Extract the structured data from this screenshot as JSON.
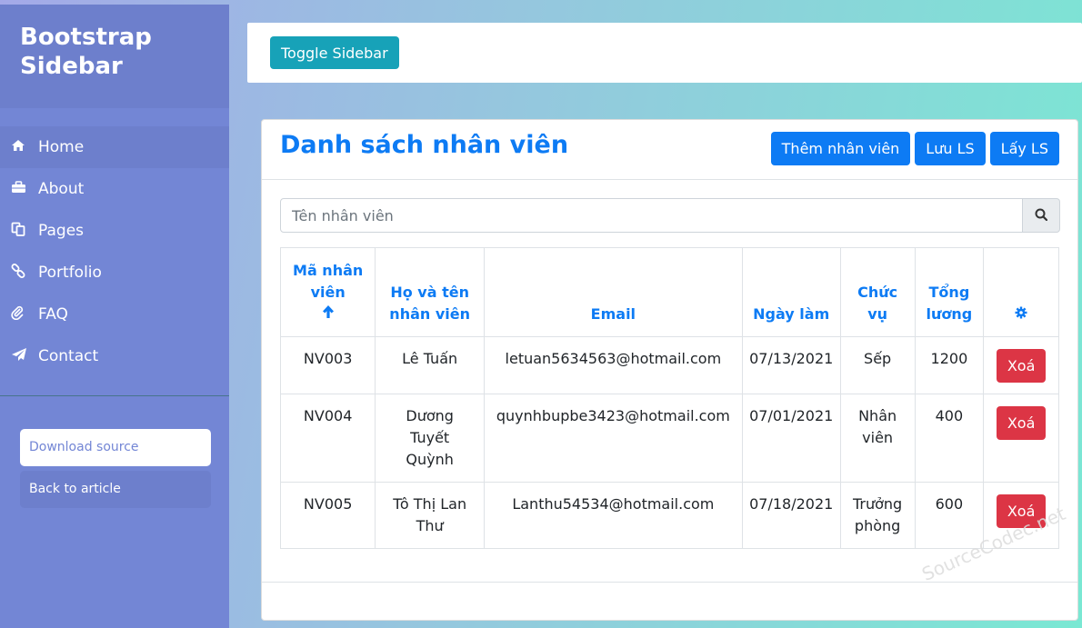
{
  "sidebar": {
    "title": "Bootstrap Sidebar",
    "items": [
      {
        "label": "Home",
        "icon": "home-icon"
      },
      {
        "label": "About",
        "icon": "briefcase-icon"
      },
      {
        "label": "Pages",
        "icon": "copy-icon"
      },
      {
        "label": "Portfolio",
        "icon": "link-icon"
      },
      {
        "label": "FAQ",
        "icon": "paperclip-icon"
      },
      {
        "label": "Contact",
        "icon": "paper-plane-icon"
      }
    ],
    "download_label": "Download source",
    "back_label": "Back to article"
  },
  "topbar": {
    "toggle_label": "Toggle Sidebar"
  },
  "card": {
    "title": "Danh sách nhân viên",
    "add_label": "Thêm nhân viên",
    "save_label": "Lưu LS",
    "load_label": "Lấy LS"
  },
  "search": {
    "placeholder": "Tên nhân viên"
  },
  "table": {
    "headers": [
      "Mã nhân viên",
      "Họ và tên nhân viên",
      "Email",
      "Ngày làm",
      "Chức vụ",
      "Tổng lương"
    ],
    "rows": [
      {
        "id": "NV003",
        "name": "Lê Tuấn",
        "email": "letuan5634563@hotmail.com",
        "date": "07/13/2021",
        "role": "Sếp",
        "salary": "1200"
      },
      {
        "id": "NV004",
        "name": "Dương Tuyết Quỳnh",
        "email": "quynhbupbe3423@hotmail.com",
        "date": "07/01/2021",
        "role": "Nhân viên",
        "salary": "400"
      },
      {
        "id": "NV005",
        "name": "Tô Thị Lan Thư",
        "email": "Lanthu54534@hotmail.com",
        "date": "07/18/2021",
        "role": "Trưởng phòng",
        "salary": "600"
      }
    ],
    "delete_label": "Xoá"
  },
  "watermark": "SourceCodec.net",
  "colors": {
    "primary": "#0d7bf4",
    "danger": "#dc3545",
    "info": "#17a2b8",
    "sidebar": "#7386d5"
  }
}
